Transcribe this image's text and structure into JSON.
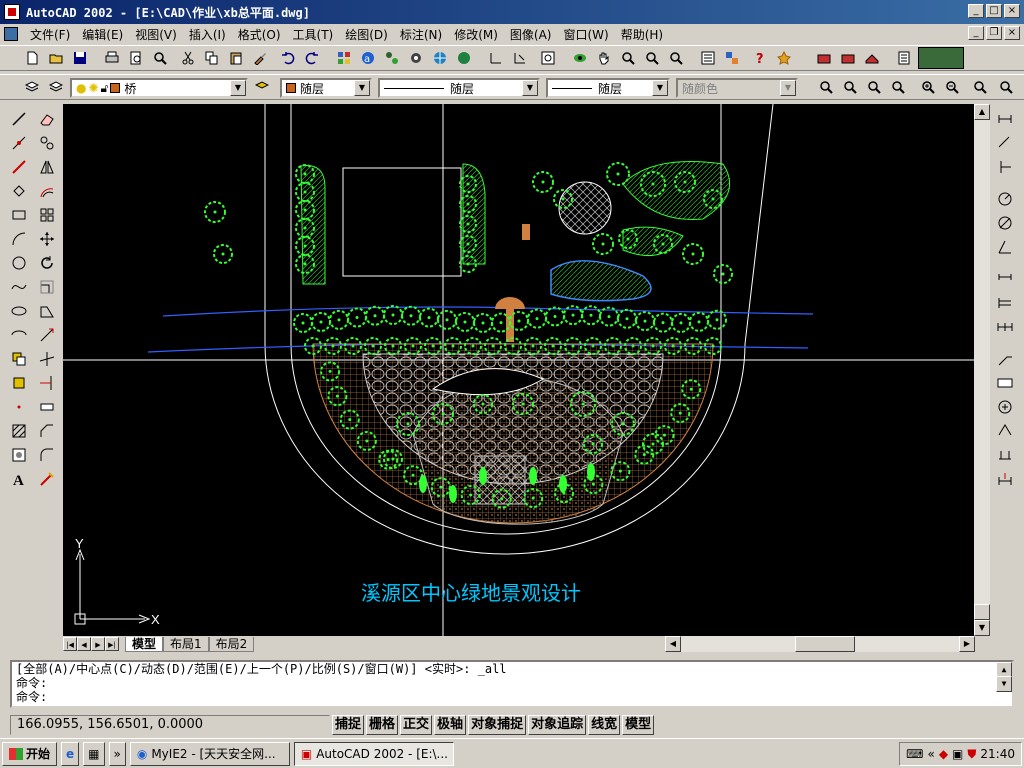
{
  "window": {
    "title": "AutoCAD 2002 - [E:\\CAD\\作业\\xb总平面.dwg]"
  },
  "menu": [
    "文件(F)",
    "编辑(E)",
    "视图(V)",
    "插入(I)",
    "格式(O)",
    "工具(T)",
    "绘图(D)",
    "标注(N)",
    "修改(M)",
    "图像(A)",
    "窗口(W)",
    "帮助(H)"
  ],
  "layers": {
    "current_layer": "桥",
    "color": "随层",
    "linetype": "随层",
    "lineweight": "随层",
    "plotstyle": "随颜色",
    "layer_color_hex": "#c8641e"
  },
  "drawing": {
    "title_text": "溪源区中心绿地景观设计",
    "title_color": "#00c8ff",
    "ucs_x": "X",
    "ucs_y": "Y",
    "plant_color": "#33ff33",
    "path_color": "#d08040",
    "water_color": "#3a8bff"
  },
  "layout_tabs": [
    "模型",
    "布局1",
    "布局2"
  ],
  "command": {
    "line1": "[全部(A)/中心点(C)/动态(D)/范围(E)/上一个(P)/比例(S)/窗口(W)] <实时>: _all",
    "line2": "命令:",
    "line3": "命令:"
  },
  "status": {
    "coords": "166.0955, 156.6501, 0.0000",
    "modes": [
      "捕捉",
      "栅格",
      "正交",
      "极轴",
      "对象捕捉",
      "对象追踪",
      "线宽",
      "模型"
    ]
  },
  "taskbar": {
    "start": "开始",
    "tasks": [
      "MyIE2 - [天天安全网...",
      "AutoCAD 2002 - [E:\\..."
    ],
    "clock": "21:40"
  }
}
